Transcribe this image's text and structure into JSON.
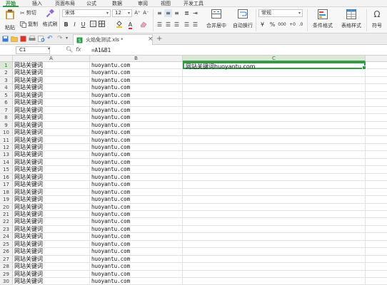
{
  "menu_tabs": [
    "开始",
    "插入",
    "页面布局",
    "公式",
    "数据",
    "审阅",
    "视图",
    "开发工具"
  ],
  "ribbon": {
    "paste_label": "粘贴",
    "cut_label": "剪切",
    "copy_label": "复制",
    "format_painter_label": "格式刷",
    "font_name": "宋体",
    "font_size": "12",
    "bold": "B",
    "italic": "I",
    "underline": "U",
    "font_color_letter": "A",
    "merge_center_label": "合并居中",
    "wrap_text_label": "自动换行",
    "number_format": "常规",
    "currency_symbol": "¥",
    "percent_symbol": "%",
    "thousands": "000",
    "cond_format_label": "条件格式",
    "table_style_label": "表格样式",
    "symbol_label": "符号"
  },
  "doc_tab": {
    "title": "火焰免测试.xls *"
  },
  "formula_bar": {
    "name_box": "C1",
    "fx": "fx",
    "formula": "=A1&B1"
  },
  "columns": [
    "A",
    "B",
    "C"
  ],
  "selected_column": "C",
  "rows": {
    "numbers": [
      "1",
      "2",
      "3",
      "4",
      "5",
      "6",
      "7",
      "8",
      "9",
      "10",
      "11",
      "12",
      "13",
      "14",
      "15",
      "16",
      "17",
      "18",
      "19",
      "20",
      "21",
      "22",
      "23",
      "24",
      "25",
      "26",
      "27",
      "28",
      "29",
      "30"
    ],
    "col_a": "网站关键词",
    "col_b": "huoyantu.com",
    "c1": "网站关键词huoyantu.com"
  },
  "colors": {
    "accent": "#2e9c47"
  }
}
